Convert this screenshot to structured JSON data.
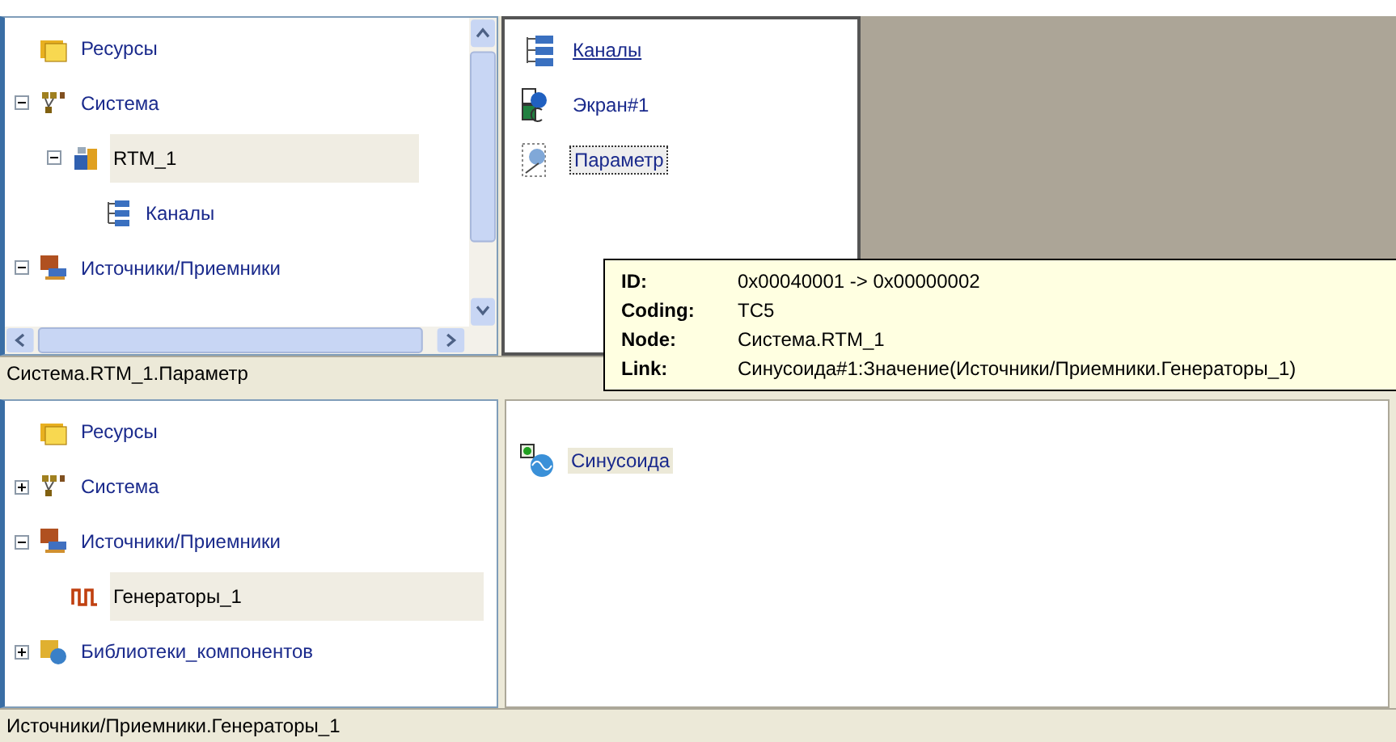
{
  "upper_tree": [
    {
      "label": "Ресурсы",
      "kind": "folder",
      "selected": false
    },
    {
      "label": "Система",
      "kind": "network",
      "expanded": true,
      "selected": false,
      "children": [
        {
          "label": "RTM_1",
          "kind": "device",
          "expanded": true,
          "selected": true,
          "children": [
            {
              "label": "Каналы",
              "kind": "channels",
              "selected": false
            }
          ]
        }
      ]
    },
    {
      "label": "Источники/Приемники",
      "kind": "io",
      "expanded": true,
      "selected": false
    }
  ],
  "upper_list": [
    {
      "label": "Каналы",
      "kind": "channels",
      "link": true,
      "selected": false
    },
    {
      "label": "Экран#1",
      "kind": "screen",
      "link": false,
      "selected": false
    },
    {
      "label": "Параметр",
      "kind": "param",
      "link": false,
      "selected": true
    }
  ],
  "upper_status": "Система.RTM_1.Параметр",
  "tooltip": [
    {
      "label": "ID:",
      "value": "0x00040001 -> 0x00000002"
    },
    {
      "label": "Coding:",
      "value": "TC5"
    },
    {
      "label": "Node:",
      "value": "Система.RTM_1"
    },
    {
      "label": "Link:",
      "value": "Синусоида#1:Значение(Источники/Приемники.Генераторы_1)"
    }
  ],
  "lower_tree": [
    {
      "label": "Ресурсы",
      "kind": "folder",
      "selected": false
    },
    {
      "label": "Система",
      "kind": "network",
      "expanded": false,
      "selected": false
    },
    {
      "label": "Источники/Приемники",
      "kind": "io",
      "expanded": true,
      "selected": false,
      "children": [
        {
          "label": "Генераторы_1",
          "kind": "generator",
          "selected": true
        }
      ]
    },
    {
      "label": "Библиотеки_компонентов",
      "kind": "library",
      "expanded": false,
      "selected": false
    }
  ],
  "lower_list": [
    {
      "label": "Синусоида",
      "kind": "sine",
      "link": false,
      "selected": true
    }
  ],
  "lower_status": "Источники/Приемники.Генераторы_1"
}
